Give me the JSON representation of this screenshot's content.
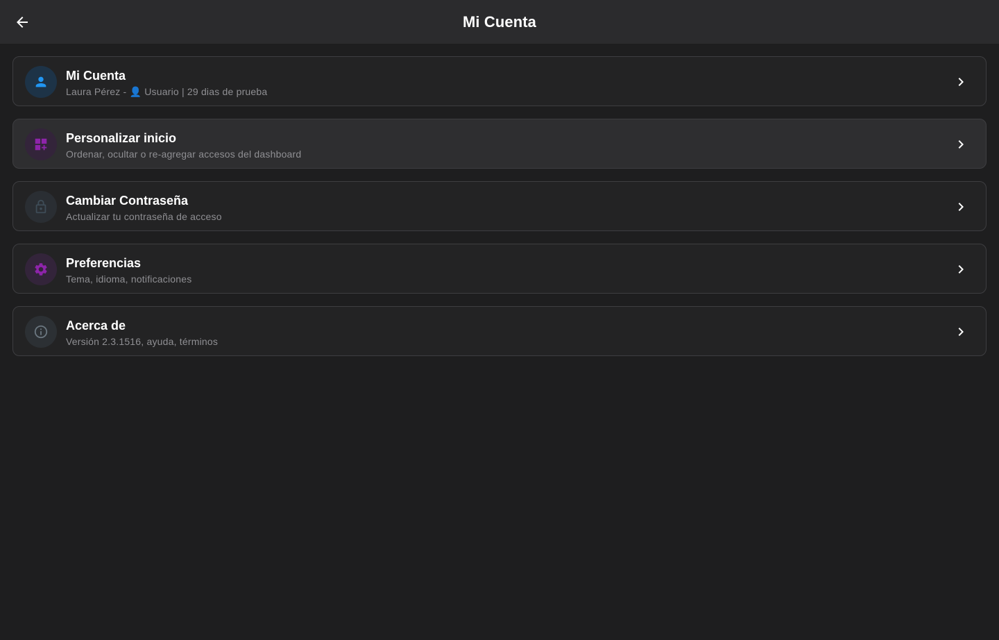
{
  "appbar": {
    "title": "Mi Cuenta",
    "back_icon": "arrow-left-icon"
  },
  "items": [
    {
      "title": "Mi Cuenta",
      "subtitle": "Laura Pérez - 👤 Usuario | 29 dias de prueba",
      "icon": "person-icon",
      "icon_color": "#2196f3",
      "icon_bg": "#1d3347"
    },
    {
      "title": "Personalizar inicio",
      "subtitle": "Ordenar, ocultar o re-agregar accesos del dashboard",
      "icon": "dashboard-add-icon",
      "icon_color": "#8e24aa",
      "icon_bg": "#33243a"
    },
    {
      "title": "Cambiar Contraseña",
      "subtitle": "Actualizar tu contraseña de acceso",
      "icon": "lock-icon",
      "icon_color": "#3e4c57",
      "icon_bg": "#2a2e33"
    },
    {
      "title": "Preferencias",
      "subtitle": "Tema, idioma, notificaciones",
      "icon": "gear-icon",
      "icon_color": "#8e24aa",
      "icon_bg": "#33243a"
    },
    {
      "title": "Acerca de",
      "subtitle": "Versión 2.3.1516, ayuda, términos",
      "icon": "info-icon",
      "icon_color": "#6b7780",
      "icon_bg": "#2c3034"
    }
  ],
  "colors": {
    "background": "#1e1e1f",
    "appbar": "#2b2b2d",
    "card": "#232324",
    "card_border": "#3e3e41",
    "subtitle": "#8f8f93"
  }
}
